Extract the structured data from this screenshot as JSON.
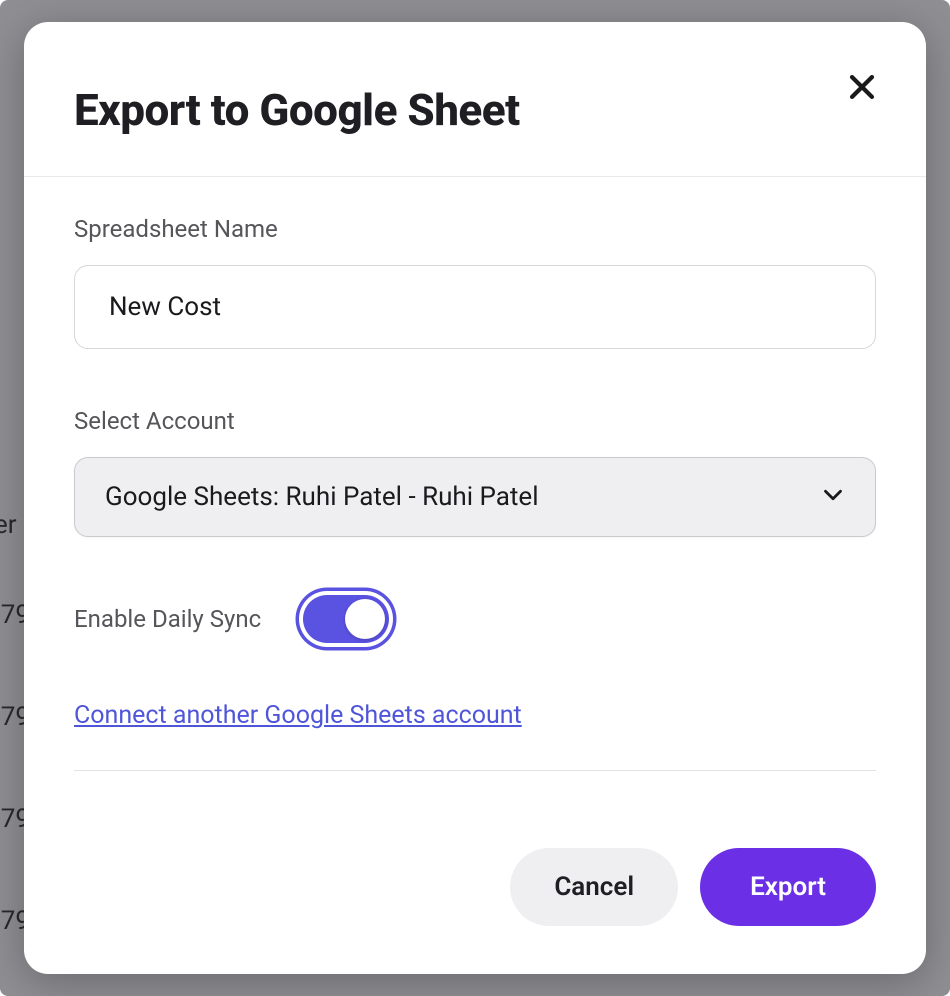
{
  "modal": {
    "title": "Export to Google Sheet",
    "close_label": "Close"
  },
  "fields": {
    "spreadsheet_name": {
      "label": "Spreadsheet Name",
      "value": "New Cost"
    },
    "account": {
      "label": "Select Account",
      "selected": "Google Sheets: Ruhi Patel - Ruhi Patel"
    },
    "daily_sync": {
      "label": "Enable Daily Sync",
      "enabled": true
    }
  },
  "links": {
    "connect_account": "Connect another Google Sheets account"
  },
  "actions": {
    "cancel": "Cancel",
    "export": "Export"
  },
  "background_rows": [
    "er",
    "·79",
    "·79",
    "·79",
    "·79"
  ]
}
